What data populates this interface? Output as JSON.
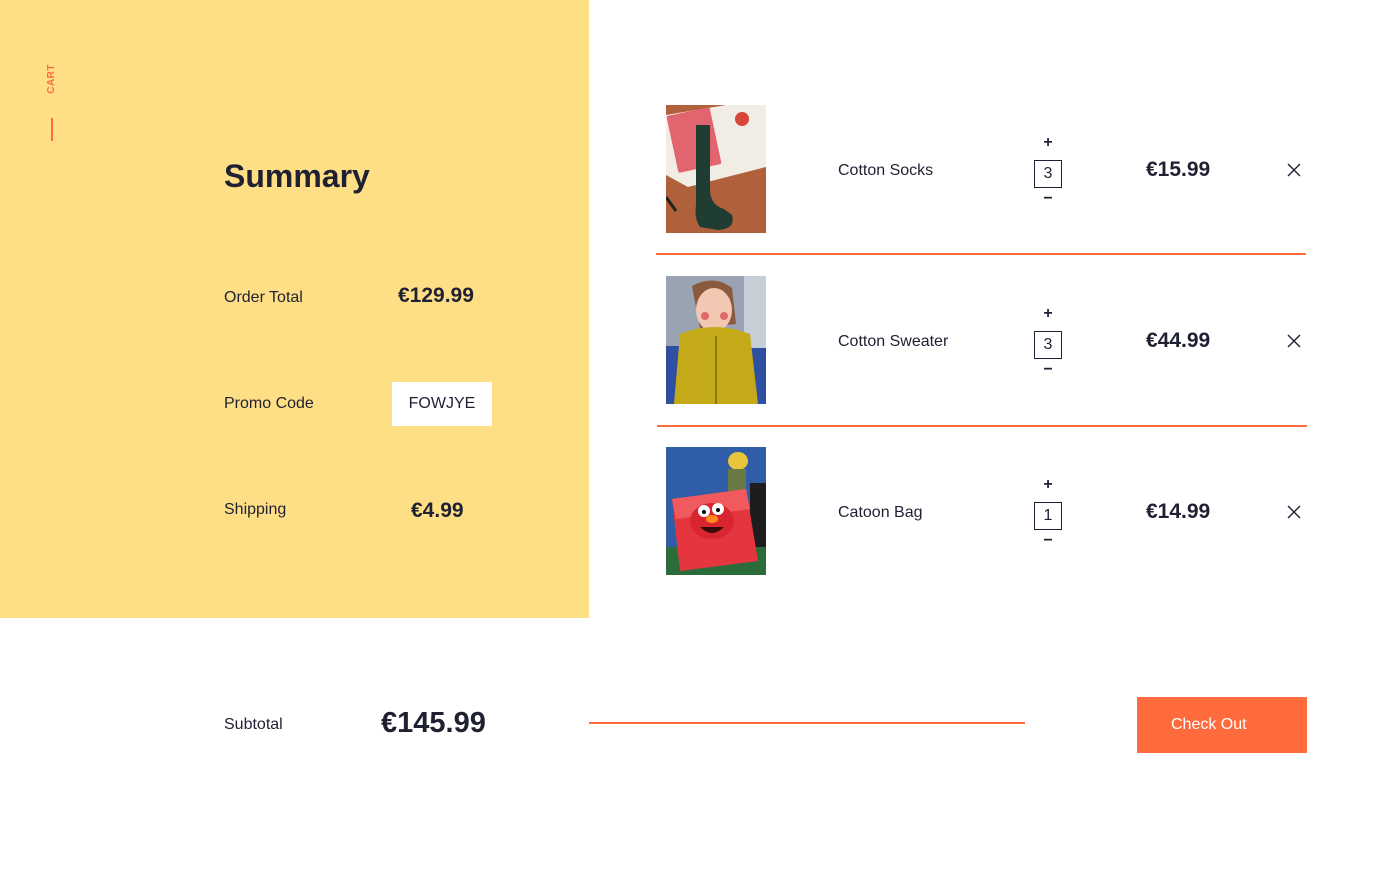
{
  "colors": {
    "panel": "#ffdf85",
    "accent": "#ff6b3d",
    "text": "#1f2133"
  },
  "nav": {
    "cart_label": "CART"
  },
  "summary": {
    "title": "Summary",
    "order_total_label": "Order Total",
    "order_total_value": "€129.99",
    "promo_label": "Promo Code",
    "promo_value": "FOWJYE",
    "shipping_label": "Shipping",
    "shipping_value": "€4.99"
  },
  "items": [
    {
      "name": "Cotton Socks",
      "quantity": "3",
      "price": "€15.99",
      "plus": "+",
      "minus": "−",
      "image_icon": "socks-photo"
    },
    {
      "name": "Cotton Sweater",
      "quantity": "3",
      "price": "€44.99",
      "plus": "+",
      "minus": "−",
      "image_icon": "sweater-photo"
    },
    {
      "name": "Catoon Bag",
      "quantity": "1",
      "price": "€14.99",
      "plus": "+",
      "minus": "−",
      "image_icon": "bag-photo"
    }
  ],
  "footer": {
    "subtotal_label": "Subtotal",
    "subtotal_value": "€145.99",
    "checkout_label": "Check Out"
  }
}
